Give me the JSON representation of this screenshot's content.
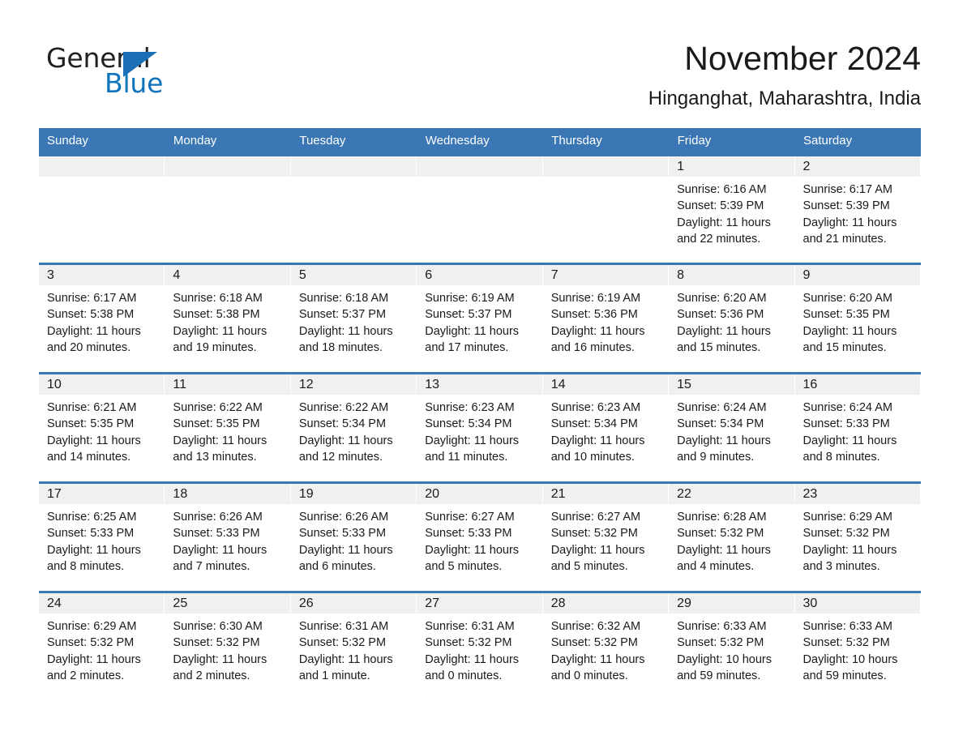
{
  "brand": {
    "name_part1": "General",
    "name_part2": "Blue",
    "logo_icon": "triangle-icon",
    "accent_color": "#1a6fb5"
  },
  "header": {
    "month_title": "November 2024",
    "location": "Hinganghat, Maharashtra, India"
  },
  "theme": {
    "header_row_bg": "#3a77b4",
    "daynum_band_bg": "#f0f0f0",
    "row_separator": "#3a77b4",
    "text_color": "#1a1a1a"
  },
  "weekday_headers": [
    "Sunday",
    "Monday",
    "Tuesday",
    "Wednesday",
    "Thursday",
    "Friday",
    "Saturday"
  ],
  "weeks": [
    [
      {
        "day": "",
        "blank": true,
        "sunrise": "",
        "sunset": "",
        "daylight_line1": "",
        "daylight_line2": ""
      },
      {
        "day": "",
        "blank": true,
        "sunrise": "",
        "sunset": "",
        "daylight_line1": "",
        "daylight_line2": ""
      },
      {
        "day": "",
        "blank": true,
        "sunrise": "",
        "sunset": "",
        "daylight_line1": "",
        "daylight_line2": ""
      },
      {
        "day": "",
        "blank": true,
        "sunrise": "",
        "sunset": "",
        "daylight_line1": "",
        "daylight_line2": ""
      },
      {
        "day": "",
        "blank": true,
        "sunrise": "",
        "sunset": "",
        "daylight_line1": "",
        "daylight_line2": ""
      },
      {
        "day": "1",
        "blank": false,
        "sunrise": "Sunrise: 6:16 AM",
        "sunset": "Sunset: 5:39 PM",
        "daylight_line1": "Daylight: 11 hours",
        "daylight_line2": "and 22 minutes."
      },
      {
        "day": "2",
        "blank": false,
        "sunrise": "Sunrise: 6:17 AM",
        "sunset": "Sunset: 5:39 PM",
        "daylight_line1": "Daylight: 11 hours",
        "daylight_line2": "and 21 minutes."
      }
    ],
    [
      {
        "day": "3",
        "blank": false,
        "sunrise": "Sunrise: 6:17 AM",
        "sunset": "Sunset: 5:38 PM",
        "daylight_line1": "Daylight: 11 hours",
        "daylight_line2": "and 20 minutes."
      },
      {
        "day": "4",
        "blank": false,
        "sunrise": "Sunrise: 6:18 AM",
        "sunset": "Sunset: 5:38 PM",
        "daylight_line1": "Daylight: 11 hours",
        "daylight_line2": "and 19 minutes."
      },
      {
        "day": "5",
        "blank": false,
        "sunrise": "Sunrise: 6:18 AM",
        "sunset": "Sunset: 5:37 PM",
        "daylight_line1": "Daylight: 11 hours",
        "daylight_line2": "and 18 minutes."
      },
      {
        "day": "6",
        "blank": false,
        "sunrise": "Sunrise: 6:19 AM",
        "sunset": "Sunset: 5:37 PM",
        "daylight_line1": "Daylight: 11 hours",
        "daylight_line2": "and 17 minutes."
      },
      {
        "day": "7",
        "blank": false,
        "sunrise": "Sunrise: 6:19 AM",
        "sunset": "Sunset: 5:36 PM",
        "daylight_line1": "Daylight: 11 hours",
        "daylight_line2": "and 16 minutes."
      },
      {
        "day": "8",
        "blank": false,
        "sunrise": "Sunrise: 6:20 AM",
        "sunset": "Sunset: 5:36 PM",
        "daylight_line1": "Daylight: 11 hours",
        "daylight_line2": "and 15 minutes."
      },
      {
        "day": "9",
        "blank": false,
        "sunrise": "Sunrise: 6:20 AM",
        "sunset": "Sunset: 5:35 PM",
        "daylight_line1": "Daylight: 11 hours",
        "daylight_line2": "and 15 minutes."
      }
    ],
    [
      {
        "day": "10",
        "blank": false,
        "sunrise": "Sunrise: 6:21 AM",
        "sunset": "Sunset: 5:35 PM",
        "daylight_line1": "Daylight: 11 hours",
        "daylight_line2": "and 14 minutes."
      },
      {
        "day": "11",
        "blank": false,
        "sunrise": "Sunrise: 6:22 AM",
        "sunset": "Sunset: 5:35 PM",
        "daylight_line1": "Daylight: 11 hours",
        "daylight_line2": "and 13 minutes."
      },
      {
        "day": "12",
        "blank": false,
        "sunrise": "Sunrise: 6:22 AM",
        "sunset": "Sunset: 5:34 PM",
        "daylight_line1": "Daylight: 11 hours",
        "daylight_line2": "and 12 minutes."
      },
      {
        "day": "13",
        "blank": false,
        "sunrise": "Sunrise: 6:23 AM",
        "sunset": "Sunset: 5:34 PM",
        "daylight_line1": "Daylight: 11 hours",
        "daylight_line2": "and 11 minutes."
      },
      {
        "day": "14",
        "blank": false,
        "sunrise": "Sunrise: 6:23 AM",
        "sunset": "Sunset: 5:34 PM",
        "daylight_line1": "Daylight: 11 hours",
        "daylight_line2": "and 10 minutes."
      },
      {
        "day": "15",
        "blank": false,
        "sunrise": "Sunrise: 6:24 AM",
        "sunset": "Sunset: 5:34 PM",
        "daylight_line1": "Daylight: 11 hours",
        "daylight_line2": "and 9 minutes."
      },
      {
        "day": "16",
        "blank": false,
        "sunrise": "Sunrise: 6:24 AM",
        "sunset": "Sunset: 5:33 PM",
        "daylight_line1": "Daylight: 11 hours",
        "daylight_line2": "and 8 minutes."
      }
    ],
    [
      {
        "day": "17",
        "blank": false,
        "sunrise": "Sunrise: 6:25 AM",
        "sunset": "Sunset: 5:33 PM",
        "daylight_line1": "Daylight: 11 hours",
        "daylight_line2": "and 8 minutes."
      },
      {
        "day": "18",
        "blank": false,
        "sunrise": "Sunrise: 6:26 AM",
        "sunset": "Sunset: 5:33 PM",
        "daylight_line1": "Daylight: 11 hours",
        "daylight_line2": "and 7 minutes."
      },
      {
        "day": "19",
        "blank": false,
        "sunrise": "Sunrise: 6:26 AM",
        "sunset": "Sunset: 5:33 PM",
        "daylight_line1": "Daylight: 11 hours",
        "daylight_line2": "and 6 minutes."
      },
      {
        "day": "20",
        "blank": false,
        "sunrise": "Sunrise: 6:27 AM",
        "sunset": "Sunset: 5:33 PM",
        "daylight_line1": "Daylight: 11 hours",
        "daylight_line2": "and 5 minutes."
      },
      {
        "day": "21",
        "blank": false,
        "sunrise": "Sunrise: 6:27 AM",
        "sunset": "Sunset: 5:32 PM",
        "daylight_line1": "Daylight: 11 hours",
        "daylight_line2": "and 5 minutes."
      },
      {
        "day": "22",
        "blank": false,
        "sunrise": "Sunrise: 6:28 AM",
        "sunset": "Sunset: 5:32 PM",
        "daylight_line1": "Daylight: 11 hours",
        "daylight_line2": "and 4 minutes."
      },
      {
        "day": "23",
        "blank": false,
        "sunrise": "Sunrise: 6:29 AM",
        "sunset": "Sunset: 5:32 PM",
        "daylight_line1": "Daylight: 11 hours",
        "daylight_line2": "and 3 minutes."
      }
    ],
    [
      {
        "day": "24",
        "blank": false,
        "sunrise": "Sunrise: 6:29 AM",
        "sunset": "Sunset: 5:32 PM",
        "daylight_line1": "Daylight: 11 hours",
        "daylight_line2": "and 2 minutes."
      },
      {
        "day": "25",
        "blank": false,
        "sunrise": "Sunrise: 6:30 AM",
        "sunset": "Sunset: 5:32 PM",
        "daylight_line1": "Daylight: 11 hours",
        "daylight_line2": "and 2 minutes."
      },
      {
        "day": "26",
        "blank": false,
        "sunrise": "Sunrise: 6:31 AM",
        "sunset": "Sunset: 5:32 PM",
        "daylight_line1": "Daylight: 11 hours",
        "daylight_line2": "and 1 minute."
      },
      {
        "day": "27",
        "blank": false,
        "sunrise": "Sunrise: 6:31 AM",
        "sunset": "Sunset: 5:32 PM",
        "daylight_line1": "Daylight: 11 hours",
        "daylight_line2": "and 0 minutes."
      },
      {
        "day": "28",
        "blank": false,
        "sunrise": "Sunrise: 6:32 AM",
        "sunset": "Sunset: 5:32 PM",
        "daylight_line1": "Daylight: 11 hours",
        "daylight_line2": "and 0 minutes."
      },
      {
        "day": "29",
        "blank": false,
        "sunrise": "Sunrise: 6:33 AM",
        "sunset": "Sunset: 5:32 PM",
        "daylight_line1": "Daylight: 10 hours",
        "daylight_line2": "and 59 minutes."
      },
      {
        "day": "30",
        "blank": false,
        "sunrise": "Sunrise: 6:33 AM",
        "sunset": "Sunset: 5:32 PM",
        "daylight_line1": "Daylight: 10 hours",
        "daylight_line2": "and 59 minutes."
      }
    ]
  ]
}
